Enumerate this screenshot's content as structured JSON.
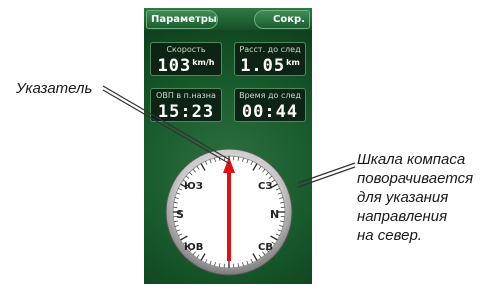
{
  "topbar": {
    "left_button": "Параметры",
    "right_button": "Сокр."
  },
  "fields": [
    {
      "label": "Скорость",
      "value": "103",
      "unit": "km/h"
    },
    {
      "label": "Расст. до след",
      "value": "1.05",
      "unit": "km"
    },
    {
      "label": "ОВП в п.назна",
      "value": "15:23",
      "unit": ""
    },
    {
      "label": "Время до след",
      "value": "00:44",
      "unit": ""
    }
  ],
  "compass": {
    "labels": {
      "n": "N",
      "s": "S",
      "nw": "СЗ",
      "ne": "",
      "sw": "ЮЗ",
      "se": "СВ",
      "s_bottom": "ЮВ"
    },
    "ticks": "72"
  },
  "callouts": {
    "pointer": "Указатель",
    "dial_lines": [
      "Шкала компаса",
      "поворачивается",
      "для указания",
      "направления",
      "на север."
    ]
  },
  "colors": {
    "device_bg": "#0f4a24",
    "needle": "#e01010",
    "field_bg": "#0d2414"
  }
}
